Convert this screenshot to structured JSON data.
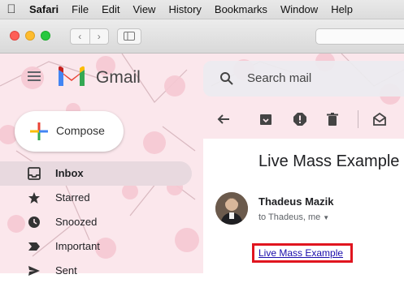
{
  "menubar": {
    "apple_icon": "apple-logo-icon",
    "items": [
      "Safari",
      "File",
      "Edit",
      "View",
      "History",
      "Bookmarks",
      "Window",
      "Help"
    ]
  },
  "toolbar": {
    "back_glyph": "‹",
    "forward_glyph": "›"
  },
  "gmail": {
    "app_name": "Gmail",
    "search_placeholder": "Search mail",
    "compose_label": "Compose",
    "nav": [
      {
        "label": "Inbox",
        "icon": "inbox-icon",
        "active": true
      },
      {
        "label": "Starred",
        "icon": "star-icon"
      },
      {
        "label": "Snoozed",
        "icon": "clock-icon"
      },
      {
        "label": "Important",
        "icon": "important-icon"
      },
      {
        "label": "Sent",
        "icon": "send-icon"
      }
    ],
    "message_toolbar_icons": [
      "back-arrow-icon",
      "archive-icon",
      "report-spam-icon",
      "delete-icon",
      "mark-unread-icon"
    ],
    "message": {
      "subject": "Live Mass Example",
      "sender": "Thadeus Mazik",
      "recipients": "to Thadeus, me",
      "recipients_caret": "▼",
      "link_text": "Live Mass Example"
    }
  },
  "colors": {
    "background_pink": "#fbe7ec",
    "highlight_red": "#e0151f",
    "link_blue": "#1a0dab"
  }
}
